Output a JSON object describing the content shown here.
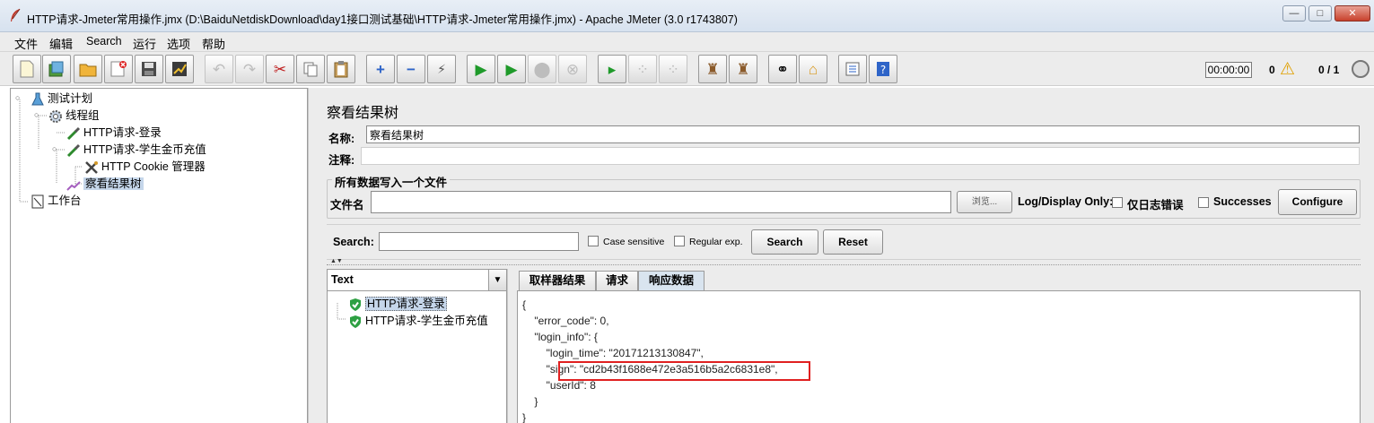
{
  "window": {
    "title": "HTTP请求-Jmeter常用操作.jmx (D:\\BaiduNetdiskDownload\\day1接口测试基础\\HTTP请求-Jmeter常用操作.jmx) - Apache JMeter (3.0 r1743807)",
    "minimize": "—",
    "maximize": "□",
    "close": "✕"
  },
  "menu": [
    "文件",
    "编辑",
    "Search",
    "运行",
    "选项",
    "帮助"
  ],
  "toolbar": {
    "timer": "00:00:00",
    "error_count": "0",
    "warning_icon": "⚠",
    "thread_count": "0 / 1"
  },
  "tree": {
    "items": [
      {
        "label": "测试计划",
        "icon": "flask-icon"
      },
      {
        "label": "线程组",
        "icon": "gear-icon"
      },
      {
        "label": "HTTP请求-登录",
        "icon": "pipette-icon"
      },
      {
        "label": "HTTP请求-学生金币充值",
        "icon": "pipette-icon"
      },
      {
        "label": "HTTP Cookie 管理器",
        "icon": "tools-icon"
      },
      {
        "label": "察看结果树",
        "icon": "graph-icon"
      },
      {
        "label": "工作台",
        "icon": "workbench-icon"
      }
    ]
  },
  "panel": {
    "title": "察看结果树",
    "name_label": "名称:",
    "name_value": "察看结果树",
    "comment_label": "注释:",
    "comment_value": "",
    "file_section_title": "所有数据写入一个文件",
    "file_label": "文件名",
    "file_value": "",
    "browse_label": "浏览...",
    "log_display_label": "Log/Display Only:",
    "errors_only_label": "仅日志错误",
    "successes_label": "Successes",
    "configure_label": "Configure"
  },
  "search": {
    "label": "Search:",
    "value": "",
    "case_sensitive_label": "Case sensitive",
    "regex_label": "Regular exp.",
    "search_button": "Search",
    "reset_button": "Reset"
  },
  "results": {
    "renderer": "Text",
    "samples": [
      {
        "label": "HTTP请求-登录",
        "status": "success",
        "selected": true
      },
      {
        "label": "HTTP请求-学生金币充值",
        "status": "success",
        "selected": false
      }
    ],
    "tabs": [
      "取样器结果",
      "请求",
      "响应数据"
    ],
    "active_tab": "响应数据",
    "response_lines": [
      "{",
      "    \"error_code\": 0,",
      "    \"login_info\": {",
      "        \"login_time\": \"20171213130847\",",
      "        \"sign\": \"cd2b43f1688e472e3a516b5a2c6831e8\",",
      "        \"userId\": 8",
      "    }",
      "}"
    ],
    "highlight_color": "#e02020"
  }
}
